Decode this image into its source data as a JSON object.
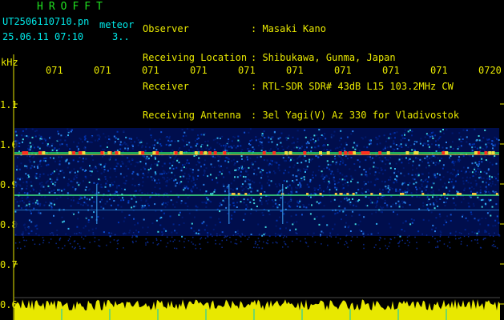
{
  "header": {
    "title": "HROFFT",
    "filename": "UT2506110710.pn",
    "filename_suffix": "meteor",
    "datetime": "25.06.11 07:10",
    "extra": "3.."
  },
  "station": [
    {
      "label": "Observer",
      "value": ": Masaki Kano"
    },
    {
      "label": "Receiving Location",
      "value": ": Shibukawa, Gunma, Japan"
    },
    {
      "label": "Receiver",
      "value": ": RTL-SDR SDR# 43dB L15 103.2MHz CW"
    },
    {
      "label": "Receiving Antenna",
      "value": ": 3el Yagi(V) Az 330 for Vladivostok"
    }
  ],
  "axis": {
    "y_unit": "kHz",
    "y_ticks": [
      "1.1",
      "1.0",
      "0.9",
      "0.8",
      "0.7",
      "0.6"
    ],
    "x_ticks": [
      "071",
      "071",
      "071",
      "071",
      "071",
      "071",
      "071",
      "071",
      "071",
      "0720"
    ]
  },
  "colors": {
    "label": "#e8e800",
    "title": "#20e020",
    "meta": "#00e8e8",
    "frame": "#e8e800"
  }
}
